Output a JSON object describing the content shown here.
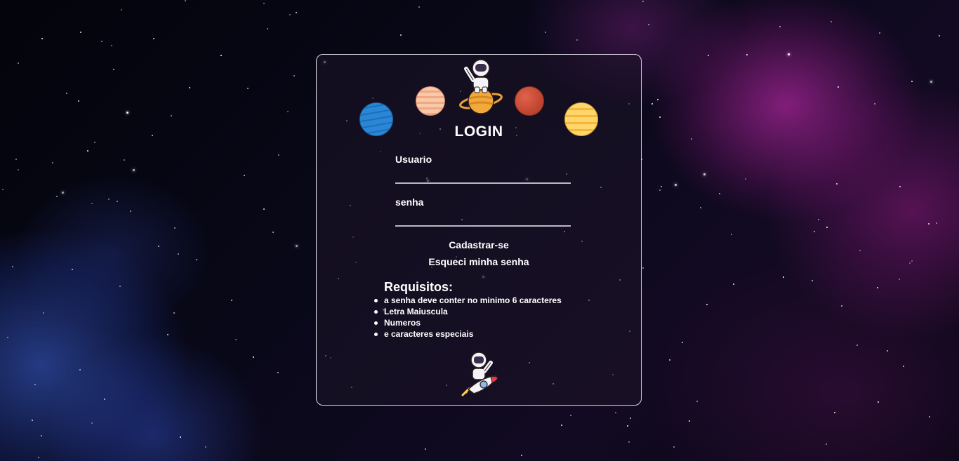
{
  "login": {
    "title": "LOGIN",
    "username_label": "Usuario",
    "username_value": "",
    "password_label": "senha",
    "password_value": "",
    "register_link": "Cadastrar-se",
    "forgot_link": "Esqueci minha senha"
  },
  "requirements": {
    "title": "Requisitos:",
    "items": [
      "a senha deve conter no minimo 6 caracteres",
      "Letra Maiuscula",
      "Numeros",
      "e caracteres especiais"
    ]
  },
  "decorations": {
    "icons": [
      "astronaut-on-planet-icon",
      "blue-planet-icon",
      "peach-planet-icon",
      "red-planet-icon",
      "yellow-planet-icon",
      "astronaut-on-rocket-icon"
    ]
  },
  "colors": {
    "text": "#ffffff",
    "card_border": "#d8d8e0",
    "input_underline": "#b9b9c2",
    "nebula_pink": "#be28aa",
    "nebula_blue": "#3c64dc"
  }
}
